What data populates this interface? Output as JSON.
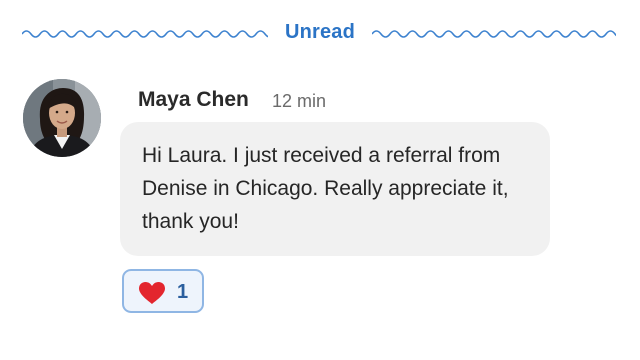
{
  "divider": {
    "label": "Unread",
    "color": "#2b74c6"
  },
  "message": {
    "sender": "Maya Chen",
    "time": "12 min",
    "text": "Hi Laura. I just received a referral from Denise in Chicago. Really appreciate it, thank you!",
    "avatar_icon": "profile-photo"
  },
  "reaction": {
    "icon": "heart-icon",
    "count": "1",
    "heart_color": "#e3262e",
    "border_color": "#8fb6e4"
  }
}
